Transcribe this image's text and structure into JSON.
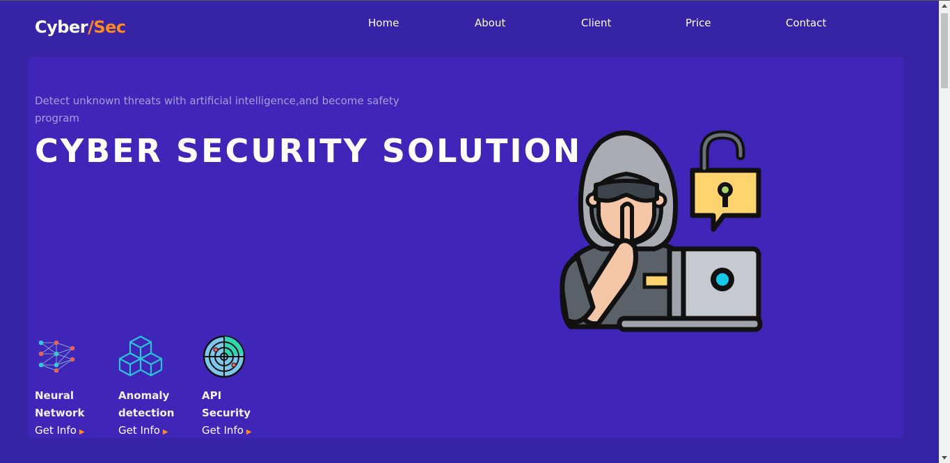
{
  "logo": {
    "part1": "Cyber",
    "separator": "/",
    "part2": "Sec"
  },
  "nav": {
    "items": [
      {
        "label": "Home"
      },
      {
        "label": "About"
      },
      {
        "label": "Client"
      },
      {
        "label": "Price"
      },
      {
        "label": "Contact"
      }
    ]
  },
  "hero": {
    "subtitle": "Detect unknown threats with artificial intelligence,and become safety program",
    "title": "CYBER SECURITY SOLUTION"
  },
  "features": [
    {
      "label": "Neural Network",
      "link": "Get Info",
      "icon": "neural-network-icon"
    },
    {
      "label": "Anomaly detection",
      "link": "Get Info",
      "icon": "cubes-icon"
    },
    {
      "label": "API Security",
      "link": "Get Info",
      "icon": "radar-icon"
    }
  ],
  "colors": {
    "background": "#3623a6",
    "hero_panel": "#4026b8",
    "accent": "#ff8a1f",
    "subtitle": "#a59ee0"
  }
}
